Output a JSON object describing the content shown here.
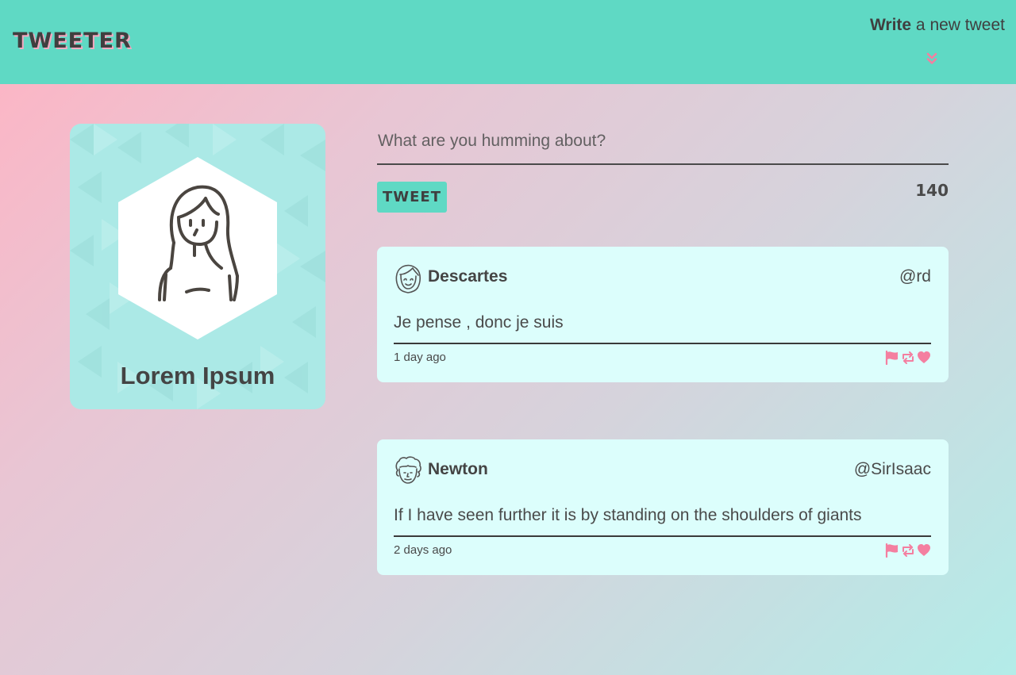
{
  "navbar": {
    "brand": "TWEETER",
    "compose_toggle": {
      "bold": "Write",
      "rest": " a new tweet",
      "icon": "double-chevron-down-icon"
    }
  },
  "profile": {
    "name": "Lorem Ipsum",
    "avatar_icon": "user-avatar-icon"
  },
  "compose": {
    "placeholder": "What are you humming about?",
    "value": "",
    "button_label": "TWEET",
    "char_count": "140"
  },
  "tweets": [
    {
      "author": "Descartes",
      "handle": "@rd",
      "content": "Je pense , donc je suis",
      "time": "1 day ago",
      "avatar_icon": "descartes-avatar-icon"
    },
    {
      "author": "Newton",
      "handle": "@SirIsaac",
      "content": "If I have seen further it is by standing on the shoulders of giants",
      "time": "2 days ago",
      "avatar_icon": "newton-avatar-icon"
    }
  ],
  "actions": {
    "flag_icon": "flag-icon",
    "retweet_icon": "retweet-icon",
    "like_icon": "heart-icon"
  },
  "colors": {
    "navbar": "#5fd9c4",
    "accent_pink": "#f47fa0",
    "card": "#dcfefc",
    "profile_card": "#abe9e6",
    "text": "#4a4a4a"
  }
}
